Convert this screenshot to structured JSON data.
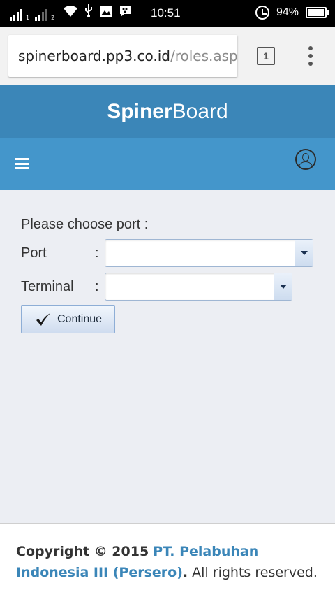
{
  "status_bar": {
    "sim1_label": "1",
    "sim2_label": "2",
    "time": "10:51",
    "battery_percent": "94%",
    "battery_level": 0.94
  },
  "browser": {
    "url_host": "spinerboard.pp3.co.id",
    "url_path": "/roles.asp",
    "tab_count": "1"
  },
  "header": {
    "brand_bold": "Spiner",
    "brand_rest": "Board",
    "brand_color": "#3b86b8",
    "nav_color": "#4496cb"
  },
  "form": {
    "prompt": "Please choose port :",
    "port_label": "Port",
    "terminal_label": "Terminal",
    "colon": ":",
    "port_value": "",
    "terminal_value": "",
    "continue_label": "Continue"
  },
  "footer": {
    "copyright": "Copyright © 2015",
    "company": "PT. Pelabuhan Indonesia III (Persero)",
    "dot": ".",
    "rights": " All rights reserved."
  },
  "icons": [
    "signal-icon",
    "wifi-icon",
    "usb-icon",
    "image-icon",
    "bbm-icon",
    "alarm-icon",
    "battery-icon",
    "hamburger-menu-icon",
    "user-icon",
    "checkmark-icon",
    "dropdown-arrow-icon",
    "overflow-menu-icon"
  ]
}
